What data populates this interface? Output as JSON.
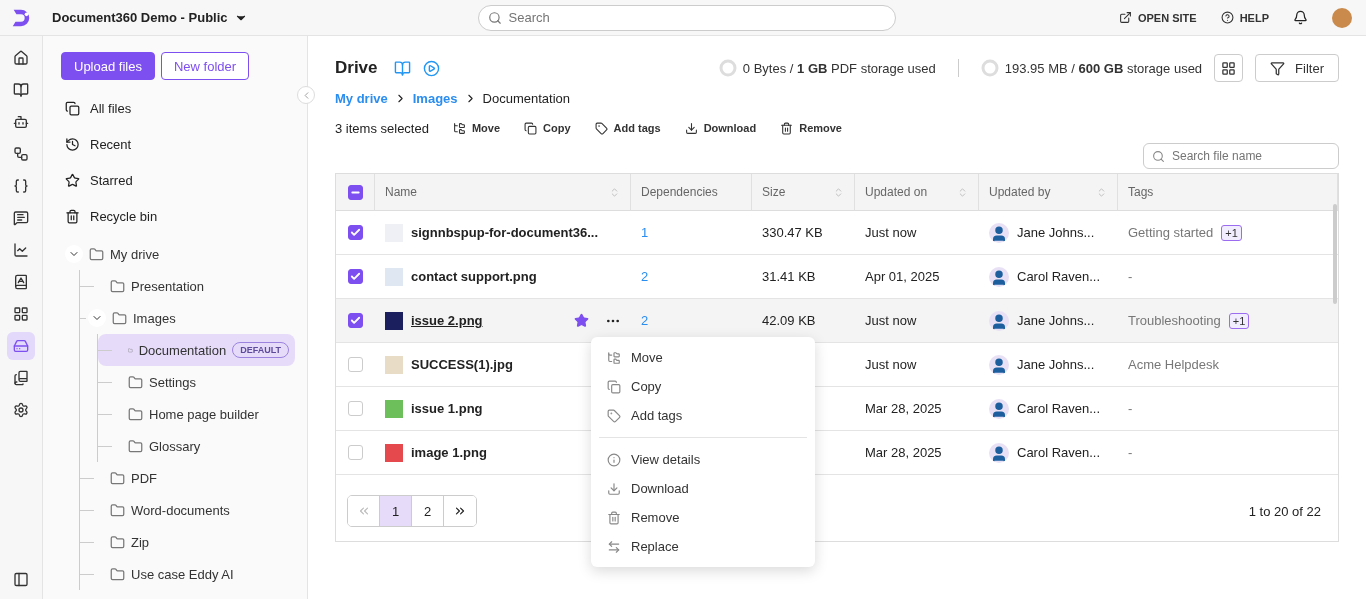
{
  "topbar": {
    "project": "Document360 Demo - Public",
    "search": {
      "placeholder": "Search"
    },
    "links": [
      "OPEN SITE",
      "HELP"
    ]
  },
  "rail": [
    {
      "selected": false
    },
    {
      "selected": false
    },
    {
      "selected": false
    },
    {
      "selected": false
    },
    {
      "selected": false
    },
    {
      "selected": false
    },
    {
      "selected": false
    },
    {
      "selected": false
    },
    {
      "selected": false
    },
    {
      "selected": true
    },
    {
      "selected": false
    },
    {
      "selected": false
    }
  ],
  "sidebar": {
    "buttons": [
      "Upload files",
      "New folder"
    ],
    "nav": [
      {
        "label": "All files",
        "selected": false
      },
      {
        "label": "Recent",
        "selected": false
      },
      {
        "label": "Starred",
        "selected": false
      },
      {
        "label": "Recycle bin",
        "selected": false
      }
    ],
    "tree": [
      {
        "label": "My drive",
        "expanded": true,
        "selected": false,
        "children": [
          {
            "label": "Presentation",
            "selected": false
          },
          {
            "label": "Images",
            "expanded": true,
            "selected": false,
            "children": [
              {
                "label": "Documentation",
                "selected": true,
                "badge": "DEFAULT"
              },
              {
                "label": "Settings",
                "selected": false
              },
              {
                "label": "Home page builder",
                "selected": false
              },
              {
                "label": "Glossary",
                "selected": false
              }
            ]
          },
          {
            "label": "PDF",
            "selected": false
          },
          {
            "label": "Word-documents",
            "selected": false
          },
          {
            "label": "Zip",
            "selected": false
          },
          {
            "label": "Use case Eddy AI",
            "selected": false
          }
        ]
      }
    ]
  },
  "main": {
    "title": "Drive",
    "storage": [
      {
        "text": "0 Bytes / **1 GB** PDF storage used"
      },
      {
        "text": "193.95 MB / **600 GB** storage used"
      }
    ],
    "filter_button": "Filter",
    "breadcrumb": [
      {
        "label": "My drive",
        "link": true
      },
      {
        "label": "Images",
        "link": true
      },
      {
        "label": "Documentation",
        "link": false
      }
    ],
    "selection_count": "3 items selected",
    "actions": [
      "Move",
      "Copy",
      "Add tags",
      "Download",
      "Remove"
    ],
    "file_search": {
      "placeholder": "Search file name"
    }
  },
  "table": {
    "select_all_indeterminate": true,
    "columns": [
      {
        "label": "Name",
        "sortable": true
      },
      {
        "label": "Dependencies",
        "sortable": false
      },
      {
        "label": "Size",
        "sortable": true
      },
      {
        "label": "Updated on",
        "sortable": true
      },
      {
        "label": "Updated by",
        "sortable": true
      },
      {
        "label": "Tags",
        "sortable": false
      }
    ],
    "rows": [
      {
        "checked": true,
        "hovered": false,
        "name": "signnbspup-for-document36...",
        "dependencies": "1",
        "size": "330.47 KB",
        "updated_on": "Just now",
        "updated_by": "Jane Johns...",
        "tag": "Getting started",
        "tag_extra": "+1"
      },
      {
        "checked": true,
        "hovered": false,
        "name": "contact support.png",
        "dependencies": "2",
        "size": "31.41 KB",
        "updated_on": "Apr 01, 2025",
        "updated_by": "Carol Raven...",
        "tag": "-"
      },
      {
        "checked": true,
        "hovered": true,
        "starred": true,
        "name": "issue 2.png",
        "dependencies": "2",
        "size": "42.09 KB",
        "updated_on": "Just now",
        "updated_by": "Jane Johns...",
        "tag": "Troubleshooting",
        "tag_extra": "+1"
      },
      {
        "checked": false,
        "hovered": false,
        "name": "SUCCESS(1).jpg",
        "updated_on": "Just now",
        "updated_by": "Jane Johns...",
        "tag": "Acme Helpdesk"
      },
      {
        "checked": false,
        "hovered": false,
        "name": "issue 1.png",
        "updated_on": "Mar 28, 2025",
        "updated_by": "Carol Raven...",
        "tag": "-"
      },
      {
        "checked": false,
        "hovered": false,
        "name": "image 1.png",
        "updated_on": "Mar 28, 2025",
        "updated_by": "Carol Raven...",
        "tag": "-"
      }
    ],
    "pagination": {
      "pages": [
        {
          "label": "1",
          "selected": true
        },
        {
          "label": "2",
          "selected": false
        }
      ],
      "prev_disabled": true,
      "next_disabled": false,
      "summary": "1 to 20 of 22"
    }
  },
  "context_menu": {
    "groups": [
      [
        "Move",
        "Copy",
        "Add tags"
      ],
      [
        "View details",
        "Download",
        "Remove",
        "Replace"
      ]
    ]
  }
}
